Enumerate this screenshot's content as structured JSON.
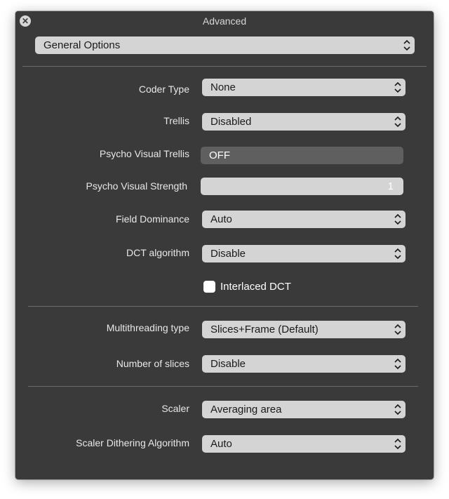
{
  "window": {
    "title": "Advanced"
  },
  "section_select": {
    "value": "General Options"
  },
  "fields": {
    "coder_type": {
      "label": "Coder Type",
      "value": "None"
    },
    "trellis": {
      "label": "Trellis",
      "value": "Disabled"
    },
    "psycho_visual_trellis": {
      "label": "Psycho Visual Trellis",
      "value": "OFF"
    },
    "psycho_visual_strength": {
      "label": "Psycho Visual Strength",
      "value": "1"
    },
    "field_dominance": {
      "label": "Field Dominance",
      "value": "Auto"
    },
    "dct_algorithm": {
      "label": "DCT algorithm",
      "value": "Disable"
    },
    "interlaced_dct": {
      "label": "Interlaced DCT",
      "checked": false
    },
    "multithreading_type": {
      "label": "Multithreading type",
      "value": "Slices+Frame (Default)"
    },
    "number_of_slices": {
      "label": "Number of slices",
      "value": "Disable"
    },
    "scaler": {
      "label": "Scaler",
      "value": "Averaging area"
    },
    "scaler_dithering": {
      "label": "Scaler Dithering Algorithm",
      "value": "Auto"
    }
  },
  "icons": {
    "close": "close-icon",
    "chevron": "chevron-up-down-icon"
  },
  "colors": {
    "window_bg": "#3a3a3a",
    "control_bg": "#d4d4d4",
    "toggle_off_bg": "#5f5f5f",
    "text_light": "#e8e8e8"
  }
}
